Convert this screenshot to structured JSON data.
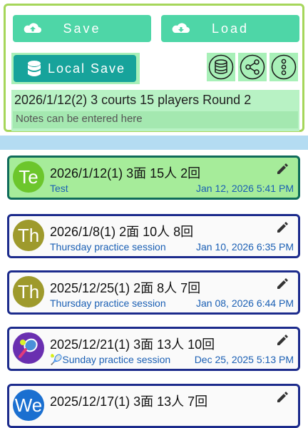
{
  "toolbar": {
    "save_label": "Save",
    "load_label": "Load",
    "local_save_label": "Local Save",
    "icons": [
      "cloud-upload-icon",
      "cloud-download-icon",
      "database-icon",
      "database-circle-icon",
      "share-icon",
      "more-vertical-icon"
    ]
  },
  "match": {
    "title": "2026/1/12(2) 3 courts 15 players Round 2",
    "notes_placeholder": "Notes can be entered here"
  },
  "sessions": [
    {
      "avatar_text": "Te",
      "avatar_color": "#6cc62c",
      "title": "2026/1/12(1) 3面 15人 2回",
      "subtitle": "Test",
      "date": "Jan 12, 2026 5:41 PM",
      "selected": true
    },
    {
      "avatar_text": "Th",
      "avatar_color": "#9e9a2c",
      "title": "2026/1/8(1) 2面 10人 8回",
      "subtitle": "Thursday practice session",
      "date": "Jan 10, 2026 6:35 PM",
      "selected": false
    },
    {
      "avatar_text": "Th",
      "avatar_color": "#9e9a2c",
      "title": "2025/12/25(1) 2面 8人 7回",
      "subtitle": "Thursday practice session",
      "date": "Jan 08, 2026 6:44 PM",
      "selected": false
    },
    {
      "avatar_text": "",
      "avatar_color": "#6a2fb0",
      "title": "2025/12/21(1) 3面 13人 10回",
      "subtitle": "🎾Sunday practice session",
      "date": "Dec 25, 2025 5:13 PM",
      "selected": false
    },
    {
      "avatar_text": "We",
      "avatar_color": "#1a6fd0",
      "title": "2025/12/17(1) 3面 13人 7回",
      "subtitle": "",
      "date": "",
      "selected": false
    }
  ],
  "colors": {
    "accent_green": "#4ed6a7",
    "teal": "#17a39b",
    "card_border": "#1c2b8c",
    "link_blue": "#1a5fb4"
  }
}
